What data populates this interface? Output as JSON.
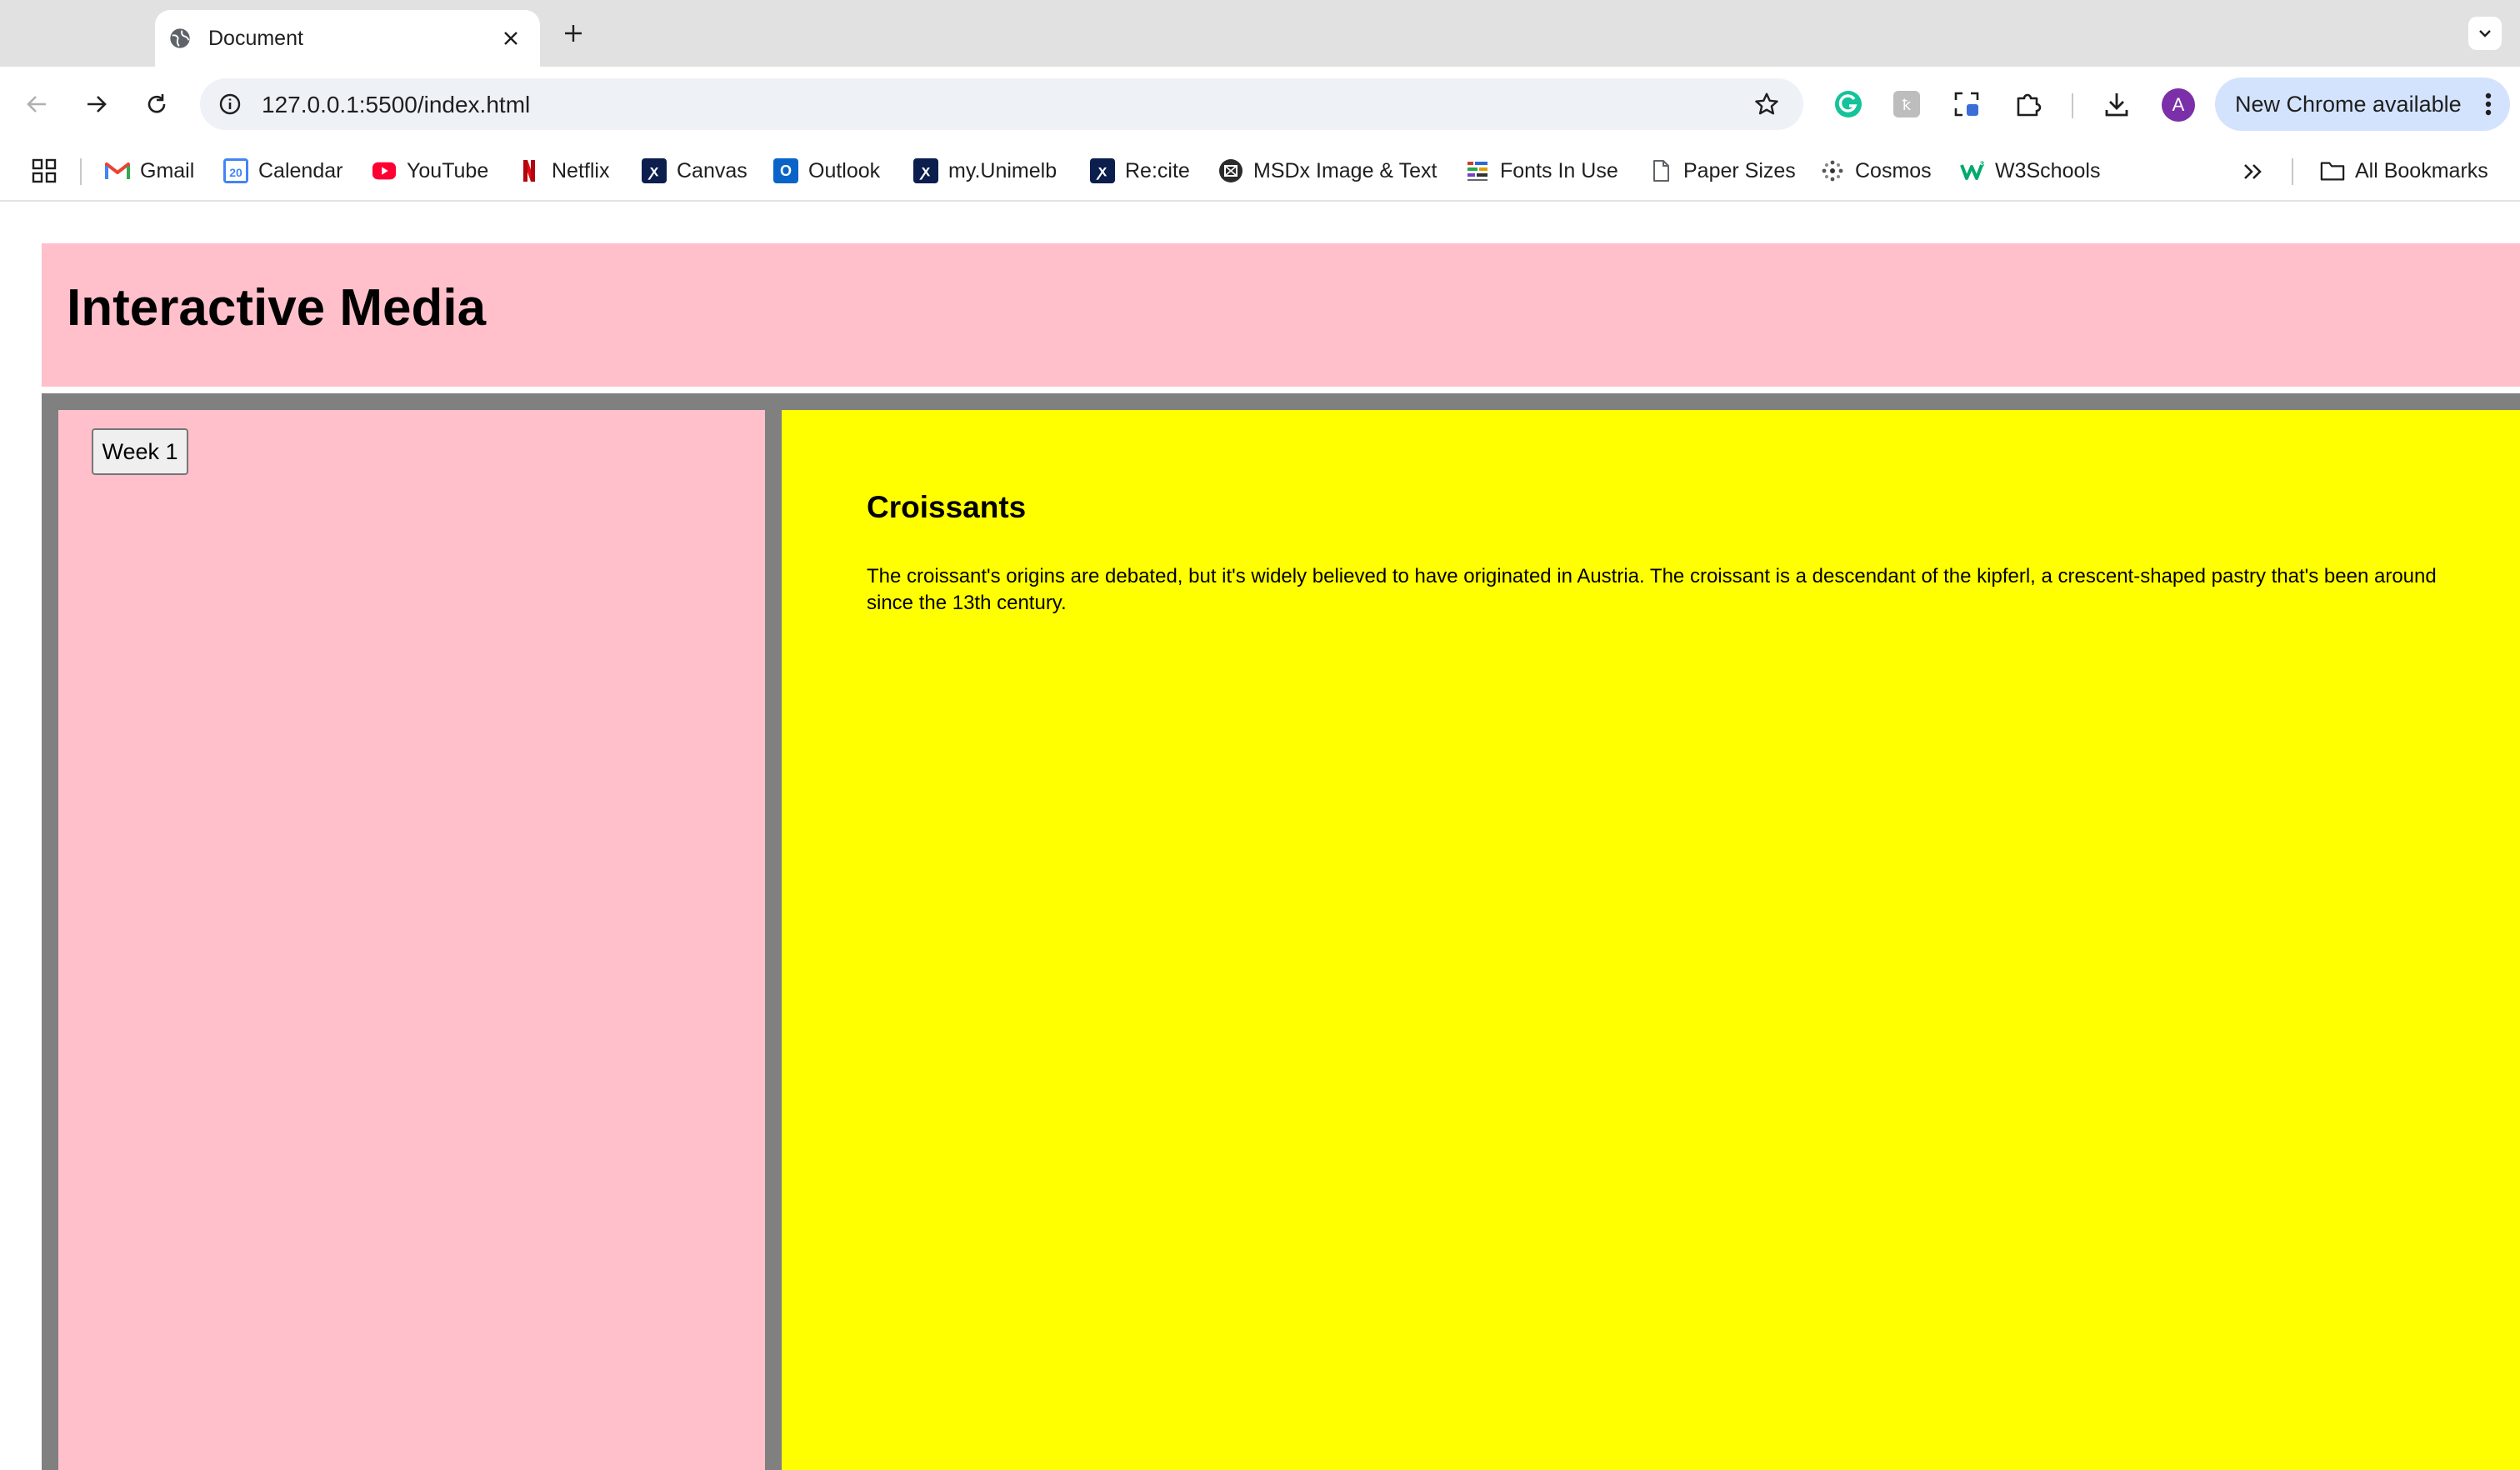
{
  "browser": {
    "tab": {
      "title": "Document"
    },
    "address_bar": {
      "url": "127.0.0.1:5500/index.html"
    },
    "profile_initial": "A",
    "update_button": "New Chrome available",
    "colors": {
      "tab_strip": "#e1e1e1",
      "omnibox": "#eef1f5",
      "update_pill": "#d3e3fd",
      "avatar": "#7b2fa8"
    }
  },
  "bookmarks": {
    "items": [
      {
        "label": "Gmail",
        "icon": "gmail-icon"
      },
      {
        "label": "Calendar",
        "icon": "calendar-icon"
      },
      {
        "label": "YouTube",
        "icon": "youtube-icon"
      },
      {
        "label": "Netflix",
        "icon": "netflix-icon"
      },
      {
        "label": "Canvas",
        "icon": "unimelb-icon"
      },
      {
        "label": "Outlook",
        "icon": "outlook-icon"
      },
      {
        "label": "my.Unimelb",
        "icon": "unimelb-icon"
      },
      {
        "label": "Re:cite",
        "icon": "unimelb-icon"
      },
      {
        "label": "MSDx Image & Text",
        "icon": "msdx-icon"
      },
      {
        "label": "Fonts In Use",
        "icon": "fontsinuse-icon"
      },
      {
        "label": "Paper Sizes",
        "icon": "page-icon"
      },
      {
        "label": "Cosmos",
        "icon": "cosmos-icon"
      },
      {
        "label": "W3Schools",
        "icon": "w3schools-icon"
      }
    ],
    "all_bookmarks": "All Bookmarks",
    "calendar_day": "20"
  },
  "page": {
    "header": {
      "title": "Interactive Media"
    },
    "sidebar": {
      "week_button": "Week 1"
    },
    "article": {
      "title": "Croissants",
      "body": "The croissant's origins are debated, but it's widely believed to have originated in Austria. The croissant is a descendant of the kipferl, a crescent-shaped pastry that's been around since the 13th century."
    },
    "colors": {
      "header_bg": "#ffc0cb",
      "frame_bg": "#808080",
      "sidebar_bg": "#ffc0cb",
      "content_bg": "#ffff00"
    }
  }
}
